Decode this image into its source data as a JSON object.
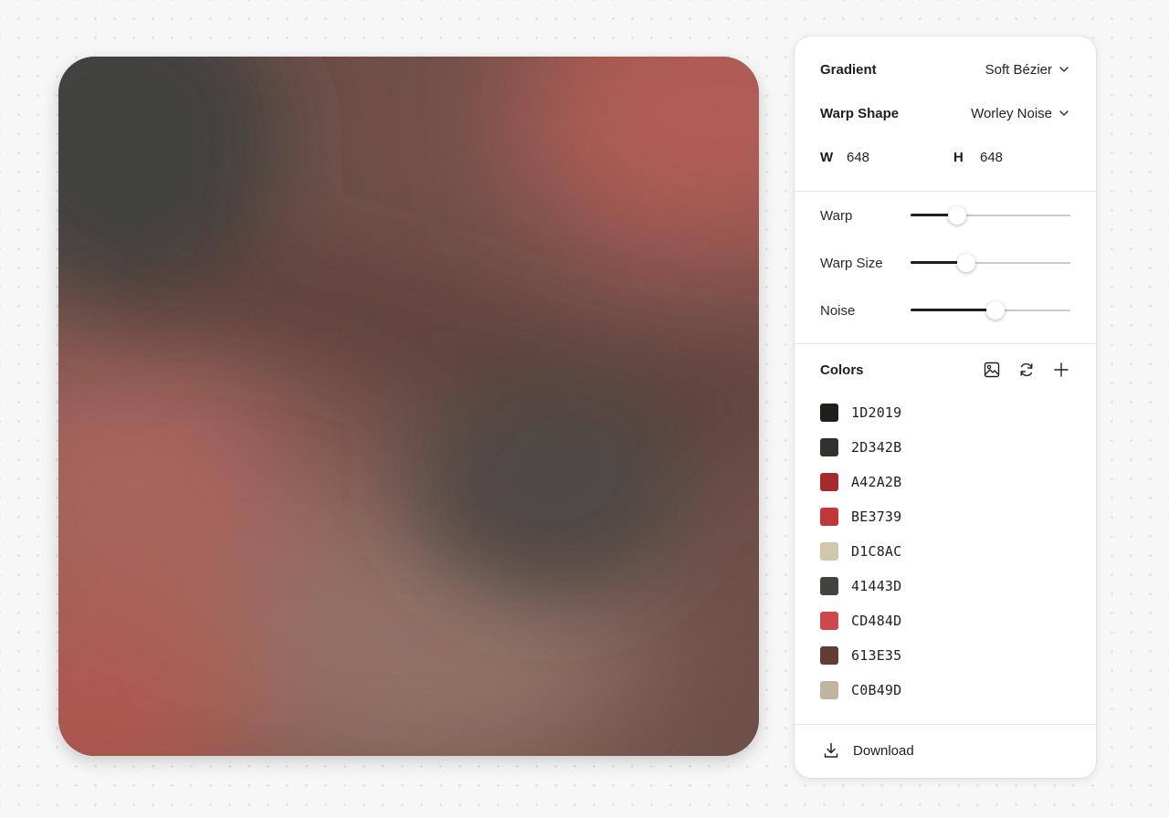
{
  "preview": {
    "colors": {
      "top_left": "#3a3a37",
      "top_right": "#b15851",
      "upper_band": "#5a3a34",
      "mid_dark": "#4a433c",
      "left_mid": "#a66058",
      "bottom_mid": "#8f6e62",
      "bottom_left": "#ae5249",
      "right_mid": "#6a4a42"
    }
  },
  "panel": {
    "gradient": {
      "label": "Gradient",
      "value": "Soft Bézier"
    },
    "warp_shape": {
      "label": "Warp Shape",
      "value": "Worley Noise"
    },
    "size": {
      "w_label": "W",
      "w_value": "648",
      "h_label": "H",
      "h_value": "648"
    },
    "sliders": [
      {
        "label": "Warp",
        "value": 0.29
      },
      {
        "label": "Warp Size",
        "value": 0.35
      },
      {
        "label": "Noise",
        "value": 0.53
      }
    ],
    "colors_section": {
      "title": "Colors",
      "icons": [
        "image-icon",
        "refresh-icon",
        "plus-icon"
      ],
      "items": [
        {
          "hex": "1D2019",
          "color": "#1D2019"
        },
        {
          "hex": "2D342B",
          "color": "#2D342B"
        },
        {
          "hex": "A42A2B",
          "color": "#A42A2B"
        },
        {
          "hex": "BE3739",
          "color": "#BE3739"
        },
        {
          "hex": "D1C8AC",
          "color": "#D1C8AC"
        },
        {
          "hex": "41443D",
          "color": "#41443D"
        },
        {
          "hex": "CD484D",
          "color": "#CD484D"
        },
        {
          "hex": "613E35",
          "color": "#613E35"
        },
        {
          "hex": "C0B49D",
          "color": "#C0B49D"
        }
      ]
    },
    "download": {
      "label": "Download"
    }
  }
}
